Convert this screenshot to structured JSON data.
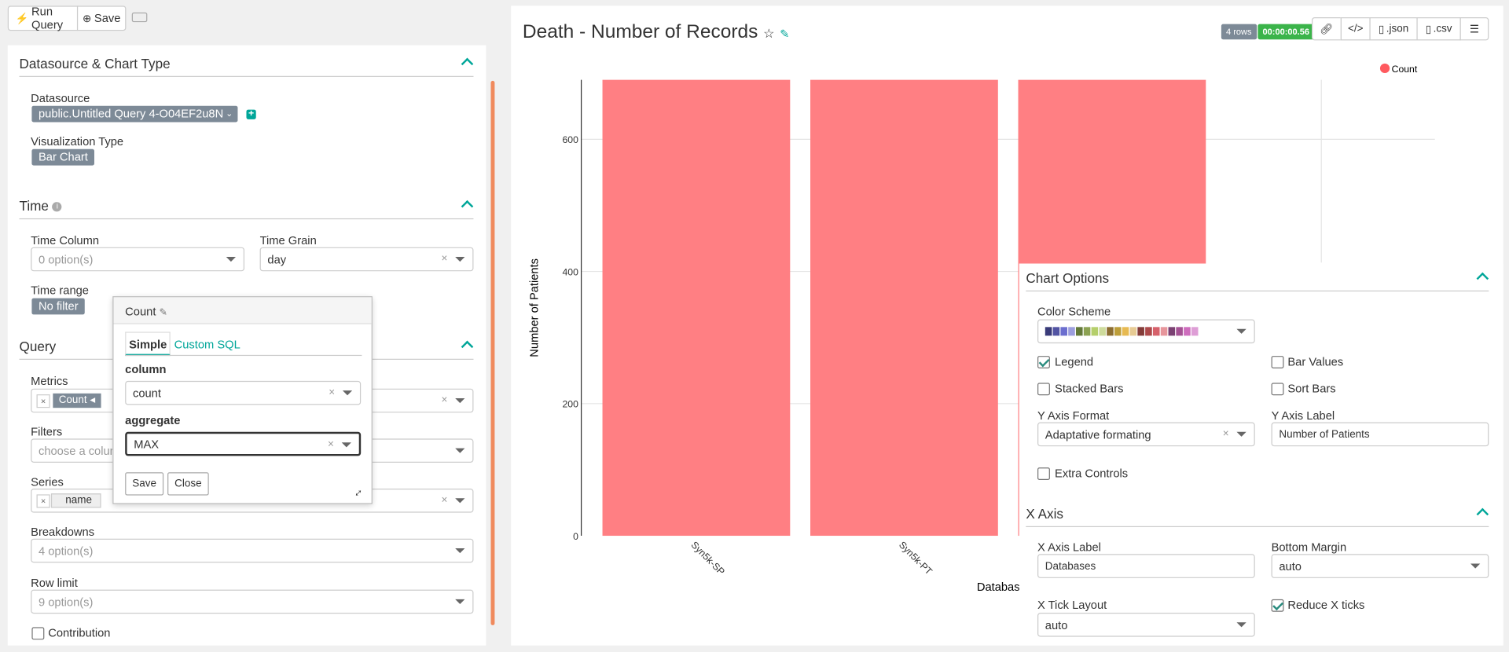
{
  "toolbar": {
    "run_query": "Run Query",
    "save": "Save",
    "run_icon": "bolt-icon",
    "save_icon": "plus-circle-icon",
    "keyboard_icon": "keyboard-icon"
  },
  "datasource_section": {
    "title": "Datasource & Chart Type",
    "datasource_label": "Datasource",
    "datasource_value": "public.Untitled Query 4-O04EF2u8N",
    "viz_label": "Visualization Type",
    "viz_value": "Bar Chart"
  },
  "time_section": {
    "title": "Time",
    "time_column_label": "Time Column",
    "time_column_placeholder": "0 option(s)",
    "time_grain_label": "Time Grain",
    "time_grain_value": "day",
    "time_range_label": "Time range",
    "time_range_value": "No filter"
  },
  "query_section": {
    "title": "Query",
    "metrics_label": "Metrics",
    "metric_tag": "Count",
    "filters_label": "Filters",
    "filters_placeholder": "choose a colum",
    "series_label": "Series",
    "series_tag": "name",
    "breakdowns_label": "Breakdowns",
    "breakdowns_placeholder": "4 option(s)",
    "row_limit_label": "Row limit",
    "row_limit_placeholder": "9 option(s)",
    "contribution_label": "Contribution"
  },
  "metric_popover": {
    "title": "Count",
    "tab_simple": "Simple",
    "tab_sql": "Custom SQL",
    "column_label": "column",
    "column_value": "count",
    "aggregate_label": "aggregate",
    "aggregate_value": "MAX",
    "save": "Save",
    "close": "Close"
  },
  "chart_header": {
    "title": "Death - Number of Records",
    "rows_badge": "4 rows",
    "time_badge": "00:00:00.56",
    "json_btn": ".json",
    "csv_btn": ".csv"
  },
  "chart_data": {
    "type": "bar",
    "categories": [
      "Syn5k-SP",
      "Syn5k-PT",
      ""
    ],
    "values": [
      690,
      690,
      690
    ],
    "ylabel": "Number of Patients",
    "xlabel": "Databases",
    "yticks": [
      "0",
      "200",
      "400",
      "600"
    ],
    "ylim": [
      0,
      690
    ],
    "legend": "Count",
    "color": "#ff7f83",
    "legend_position": "top-right",
    "grid": true
  },
  "chart_options": {
    "title": "Chart Options",
    "color_scheme_label": "Color Scheme",
    "swatches": [
      "#393b79",
      "#5254a3",
      "#6b6ecf",
      "#9c9ede",
      "#637939",
      "#8ca252",
      "#b5cf6b",
      "#cedb9c",
      "#8c6d31",
      "#bd9e39",
      "#e7ba52",
      "#e7cb94",
      "#843c39",
      "#ad494a",
      "#d6616b",
      "#e7969c",
      "#7b4173",
      "#a55194",
      "#ce6dbd",
      "#de9ed6"
    ],
    "legend_label": "Legend",
    "bar_values_label": "Bar Values",
    "stacked_bars_label": "Stacked Bars",
    "sort_bars_label": "Sort Bars",
    "y_axis_format_label": "Y Axis Format",
    "y_axis_format_value": "Adaptative formating",
    "y_axis_label_label": "Y Axis Label",
    "y_axis_label_value": "Number of Patients",
    "extra_controls_label": "Extra Controls"
  },
  "x_axis_section": {
    "title": "X Axis",
    "x_axis_label_label": "X Axis Label",
    "x_axis_label_value": "Databases",
    "bottom_margin_label": "Bottom Margin",
    "bottom_margin_value": "auto",
    "x_tick_layout_label": "X Tick Layout",
    "x_tick_layout_value": "auto",
    "reduce_x_ticks_label": "Reduce X ticks"
  }
}
